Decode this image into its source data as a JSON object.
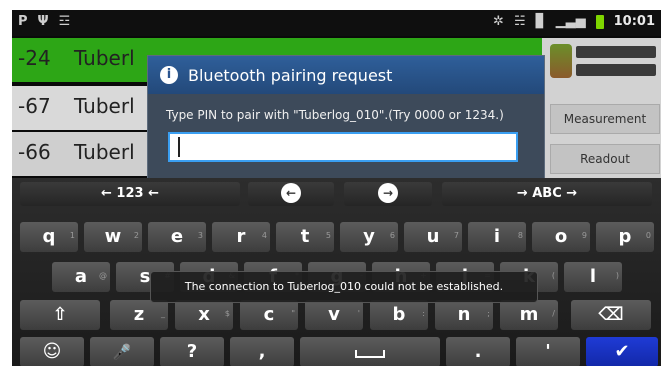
{
  "status_bar": {
    "left_icons": [
      "P",
      "Ψ",
      "☲"
    ],
    "right_icons": [
      "✲",
      "☵",
      "▊",
      "▁▃▅"
    ],
    "time": "10:01",
    "battery_color": "#7fd600"
  },
  "device_list": [
    {
      "rssi": "-24",
      "name": "Tuberl",
      "color": "#2da616"
    },
    {
      "rssi": "-67",
      "name": "Tuberl"
    },
    {
      "rssi": "-66",
      "name": "Tuberl"
    }
  ],
  "side_panel": {
    "measurement_label": "Measurement",
    "readout_label": "Readout"
  },
  "dialog": {
    "title": "Bluetooth pairing request",
    "message": "Type PIN to pair with \"Tuberlog_010\".(Try 0000 or 1234.)",
    "pin_value": ""
  },
  "keyboard": {
    "fn_row": {
      "left": "← 123 ←",
      "back": "←",
      "forward": "→",
      "right": "→ ABC →"
    },
    "row1": [
      {
        "k": "q",
        "s": "1"
      },
      {
        "k": "w",
        "s": "2"
      },
      {
        "k": "e",
        "s": "3"
      },
      {
        "k": "r",
        "s": "4"
      },
      {
        "k": "t",
        "s": "5"
      },
      {
        "k": "y",
        "s": "6"
      },
      {
        "k": "u",
        "s": "7"
      },
      {
        "k": "i",
        "s": "8"
      },
      {
        "k": "o",
        "s": "9"
      },
      {
        "k": "p",
        "s": "0"
      }
    ],
    "row2": [
      {
        "k": "a",
        "s": "@"
      },
      {
        "k": "s",
        "s": "#"
      },
      {
        "k": "d",
        "s": "&"
      },
      {
        "k": "f",
        "s": "*"
      },
      {
        "k": "g",
        "s": "-"
      },
      {
        "k": "h",
        "s": "+"
      },
      {
        "k": "j",
        "s": "="
      },
      {
        "k": "k",
        "s": "("
      },
      {
        "k": "l",
        "s": ")"
      }
    ],
    "row3": [
      {
        "k": "z",
        "s": "_"
      },
      {
        "k": "x",
        "s": "$"
      },
      {
        "k": "c",
        "s": "\""
      },
      {
        "k": "v",
        "s": "'"
      },
      {
        "k": "b",
        "s": ":"
      },
      {
        "k": "n",
        "s": ";"
      },
      {
        "k": "m",
        "s": "/"
      }
    ],
    "shift": "⇧",
    "delete": "⌫",
    "row4": {
      "smiley": "☺",
      "mic": "🎤",
      "question": "?",
      "comma": ",",
      "period": ".",
      "apostrophe": "'",
      "done": "✔"
    }
  },
  "toast": "The connection to   Tuberlog_010   could not be established."
}
